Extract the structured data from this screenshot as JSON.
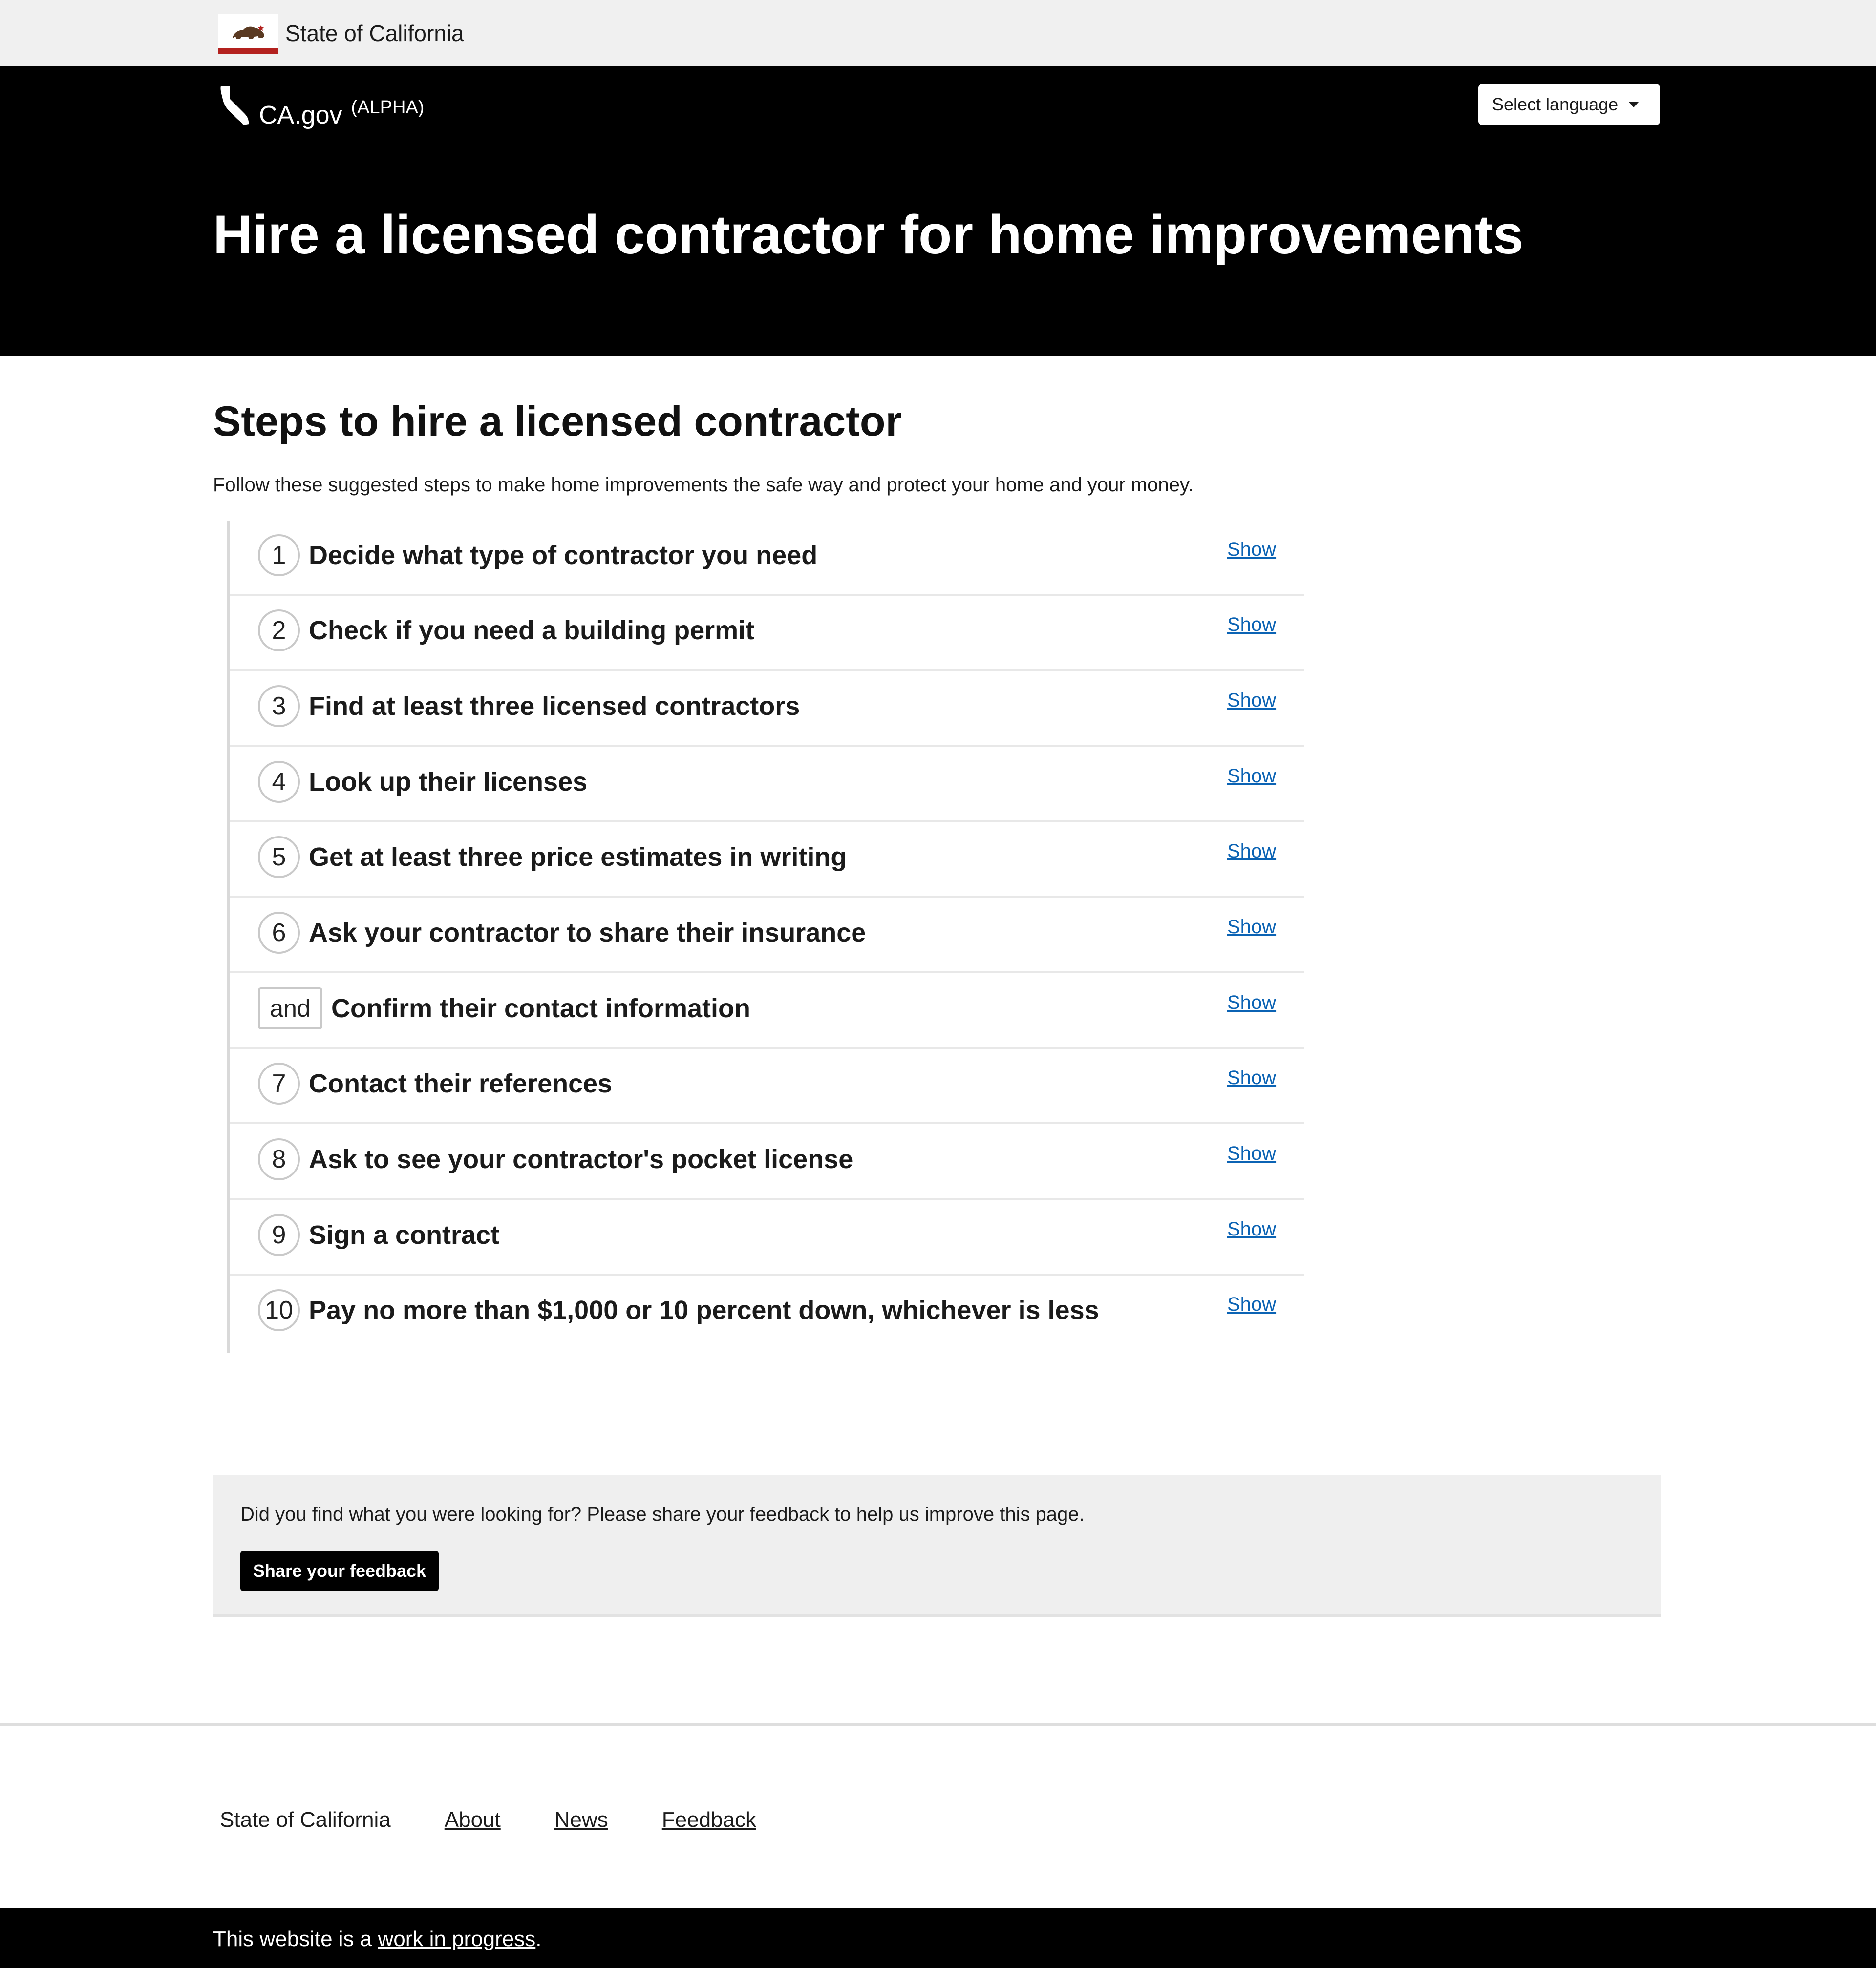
{
  "utility": {
    "label": "State of California",
    "flag_icon": "california-flag-icon"
  },
  "header": {
    "brand_name": "CA.gov",
    "brand_tag": "(ALPHA)",
    "brand_icon": "california-state-outline-icon",
    "language_select": "Select language",
    "page_title": "Hire a licensed contractor for home improvements"
  },
  "main": {
    "section_title": "Steps to hire a licensed contractor",
    "intro": "Follow these suggested steps to make home improvements the safe way and protect your home and your money.",
    "show_label": "Show",
    "steps": [
      {
        "marker": "1",
        "label": "Decide what type of contractor you need"
      },
      {
        "marker": "2",
        "label": "Check if you need a building permit"
      },
      {
        "marker": "3",
        "label": "Find at least three licensed contractors"
      },
      {
        "marker": "4",
        "label": "Look up their licenses"
      },
      {
        "marker": "5",
        "label": "Get at least three price estimates in writing"
      },
      {
        "marker": "6",
        "label": "Ask your contractor to share their insurance"
      },
      {
        "marker": "and",
        "label": "Confirm their contact information"
      },
      {
        "marker": "7",
        "label": "Contact their references"
      },
      {
        "marker": "8",
        "label": "Ask to see your contractor's pocket license"
      },
      {
        "marker": "9",
        "label": "Sign a contract"
      },
      {
        "marker": "10",
        "label": "Pay no more than $1,000 or 10 percent down, whichever is less"
      }
    ]
  },
  "feedback": {
    "prompt": "Did you find what you were looking for? Please share your feedback to help us improve this page.",
    "button": "Share your feedback"
  },
  "footer": {
    "brand": "State of California",
    "links": [
      "About",
      "News",
      "Feedback"
    ]
  },
  "bottom_bar": {
    "prefix": "This website is a ",
    "link": "work in progress",
    "suffix": "."
  },
  "colors": {
    "header_bg": "#000000",
    "link": "#0b63b4",
    "flag_red": "#b3211e"
  }
}
